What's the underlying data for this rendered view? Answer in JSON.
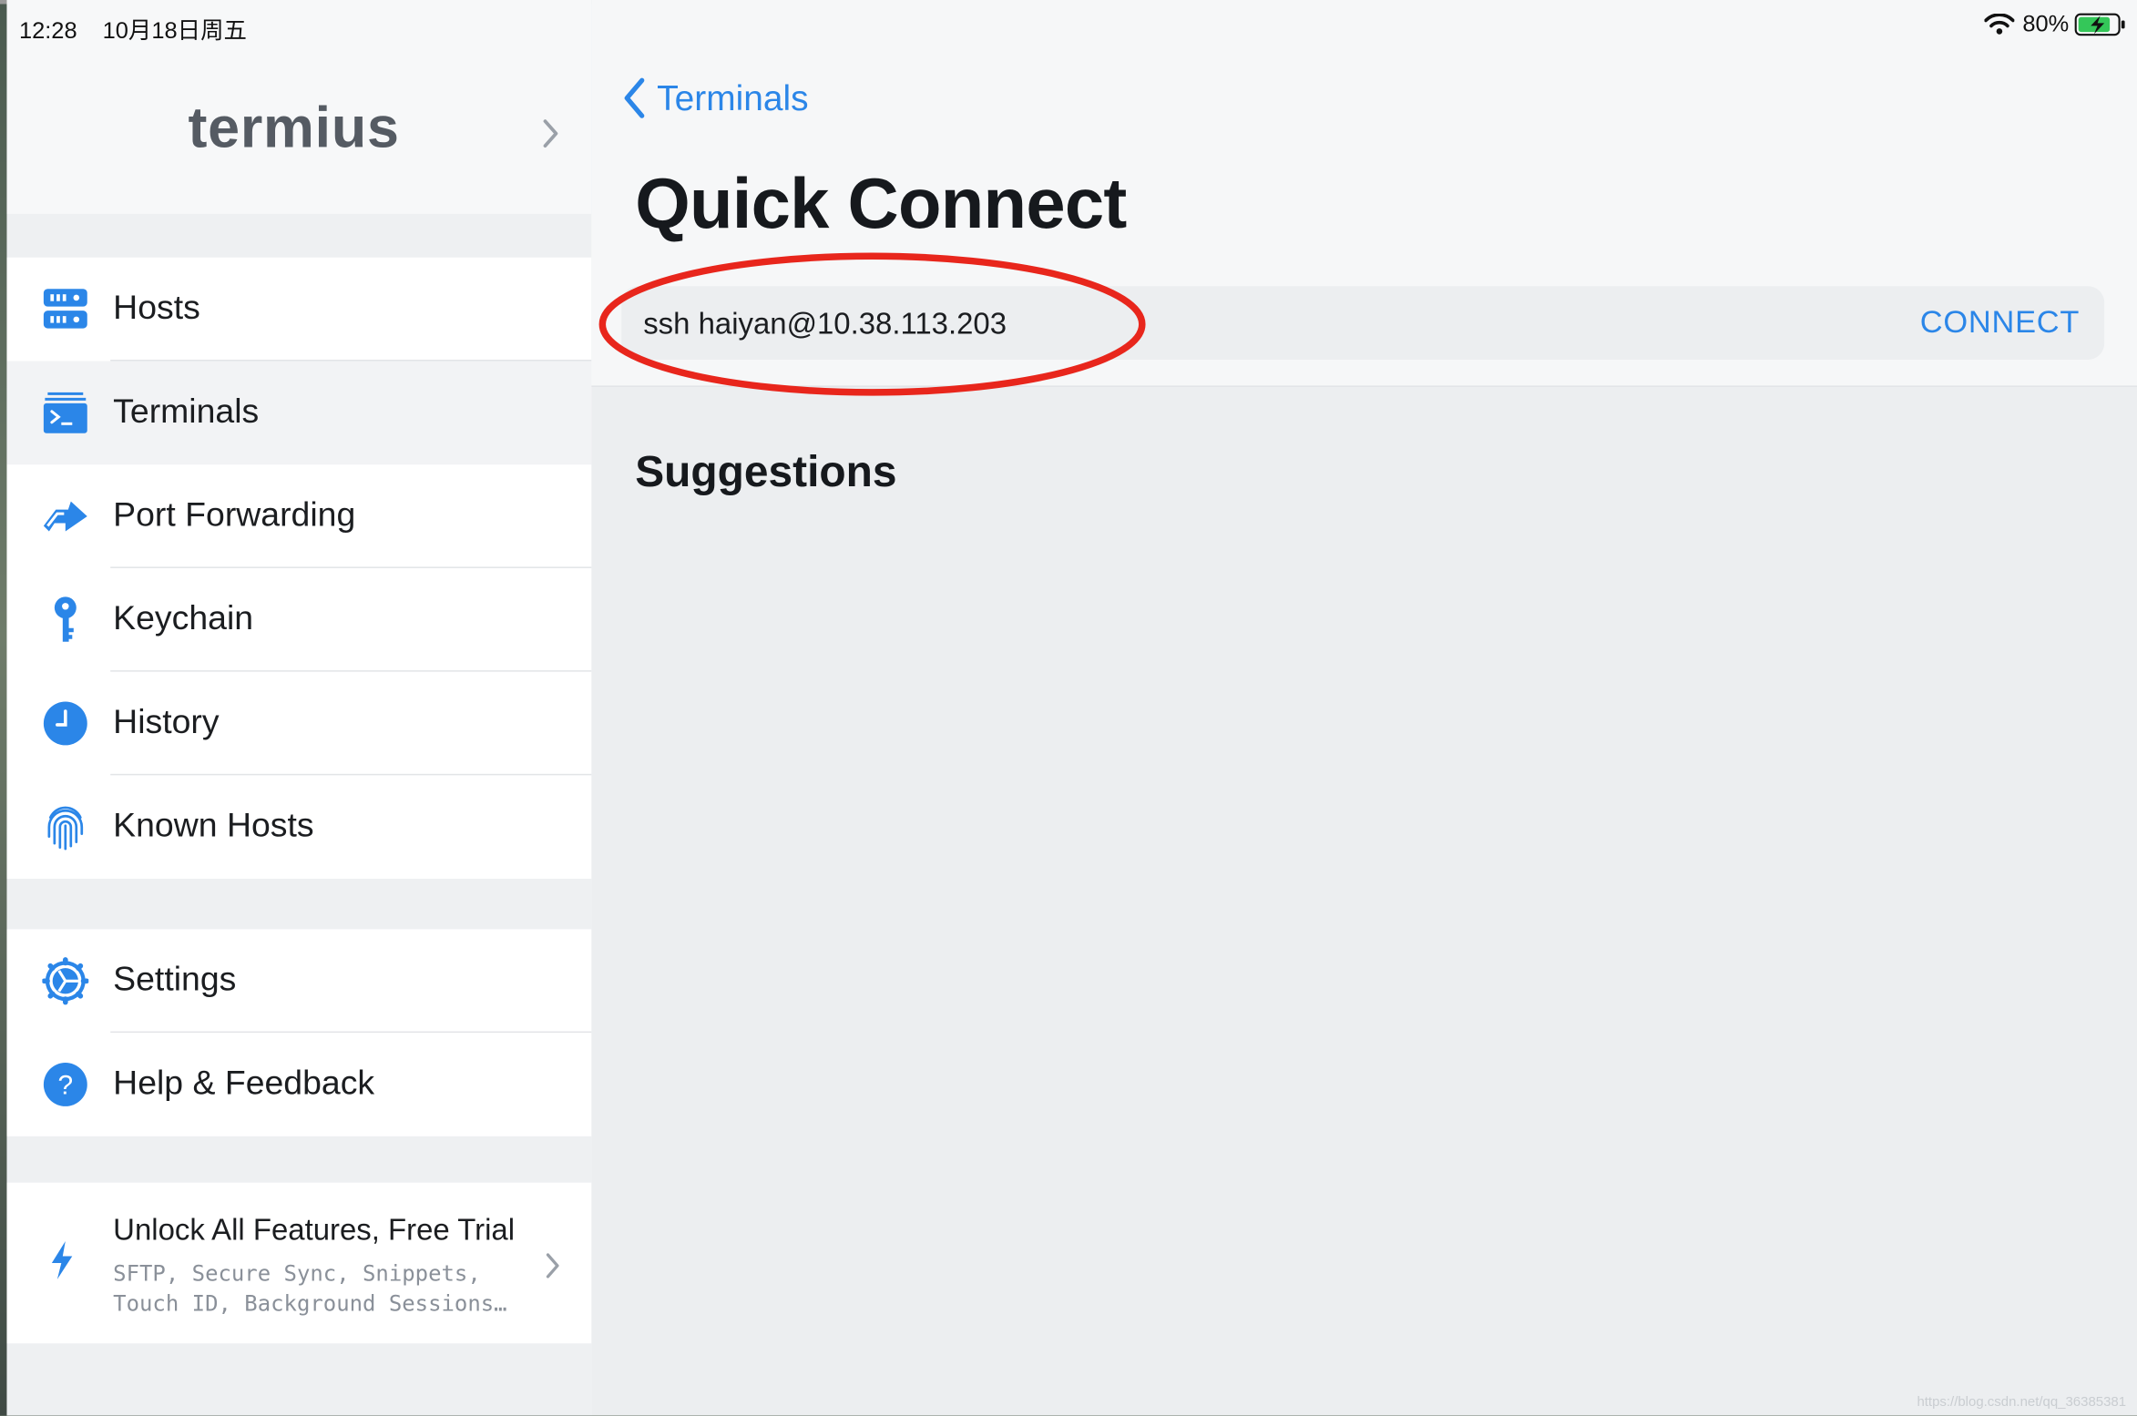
{
  "status_bar": {
    "time": "12:28",
    "date": "10月18日周五",
    "battery": "80%"
  },
  "sidebar": {
    "logo": "termius",
    "items": [
      {
        "label": "Hosts",
        "icon": "server-icon"
      },
      {
        "label": "Terminals",
        "icon": "terminal-icon",
        "selected": true
      },
      {
        "label": "Port Forwarding",
        "icon": "arrow-forward-icon"
      },
      {
        "label": "Keychain",
        "icon": "key-icon"
      },
      {
        "label": "History",
        "icon": "clock-icon"
      },
      {
        "label": "Known Hosts",
        "icon": "fingerprint-icon"
      }
    ],
    "secondary_items": [
      {
        "label": "Settings",
        "icon": "gear-icon"
      },
      {
        "label": "Help & Feedback",
        "icon": "help-icon"
      }
    ],
    "promo": {
      "title": "Unlock All Features, Free Trial",
      "subtitle_line1": "SFTP, Secure Sync, Snippets,",
      "subtitle_line2": "Touch ID, Background Sessions…"
    }
  },
  "main": {
    "back_label": "Terminals",
    "title": "Quick Connect",
    "command_value": "ssh haiyan@10.38.113.203",
    "connect_label": "CONNECT",
    "suggestions_title": "Suggestions",
    "watermark": "https://blog.csdn.net/qq_36385381"
  },
  "colors": {
    "accent": "#2b86e8",
    "annotation": "#e8261c",
    "sidebar_bg": "#eef0f2",
    "main_bg": "#eceef0"
  }
}
